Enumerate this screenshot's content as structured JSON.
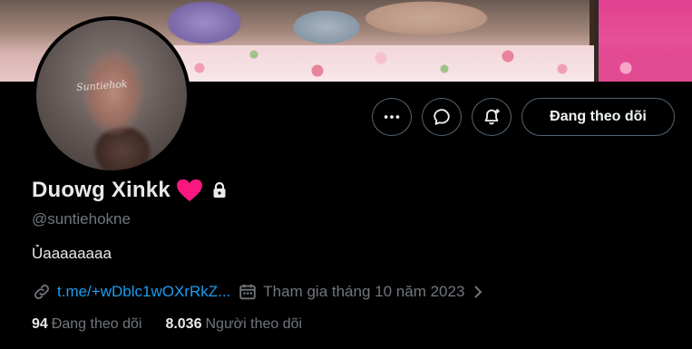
{
  "profile": {
    "display_name": "Duowg Xinkk",
    "handle": "@suntiehokne",
    "bio": "Ủaaaaaaaa",
    "avatar_signature": "Suntiehok",
    "link": "t.me/+wDblc1wOXrRkZ...",
    "joined": "Tham gia tháng 10 năm 2023"
  },
  "actions": {
    "more_icon": "more-horizontal-icon",
    "message_icon": "message-icon",
    "notify_icon": "notification-bell-plus-icon",
    "follow_label": "Đang theo dõi"
  },
  "stats": {
    "following_count": "94",
    "following_label": "Đang theo dõi",
    "followers_count": "8.036",
    "followers_label": "Người theo dõi"
  },
  "colors": {
    "background": "#000000",
    "text": "#e7e9ea",
    "muted": "#71767b",
    "link": "#1d9bf0",
    "heart": "#f91880",
    "border": "#536471"
  }
}
